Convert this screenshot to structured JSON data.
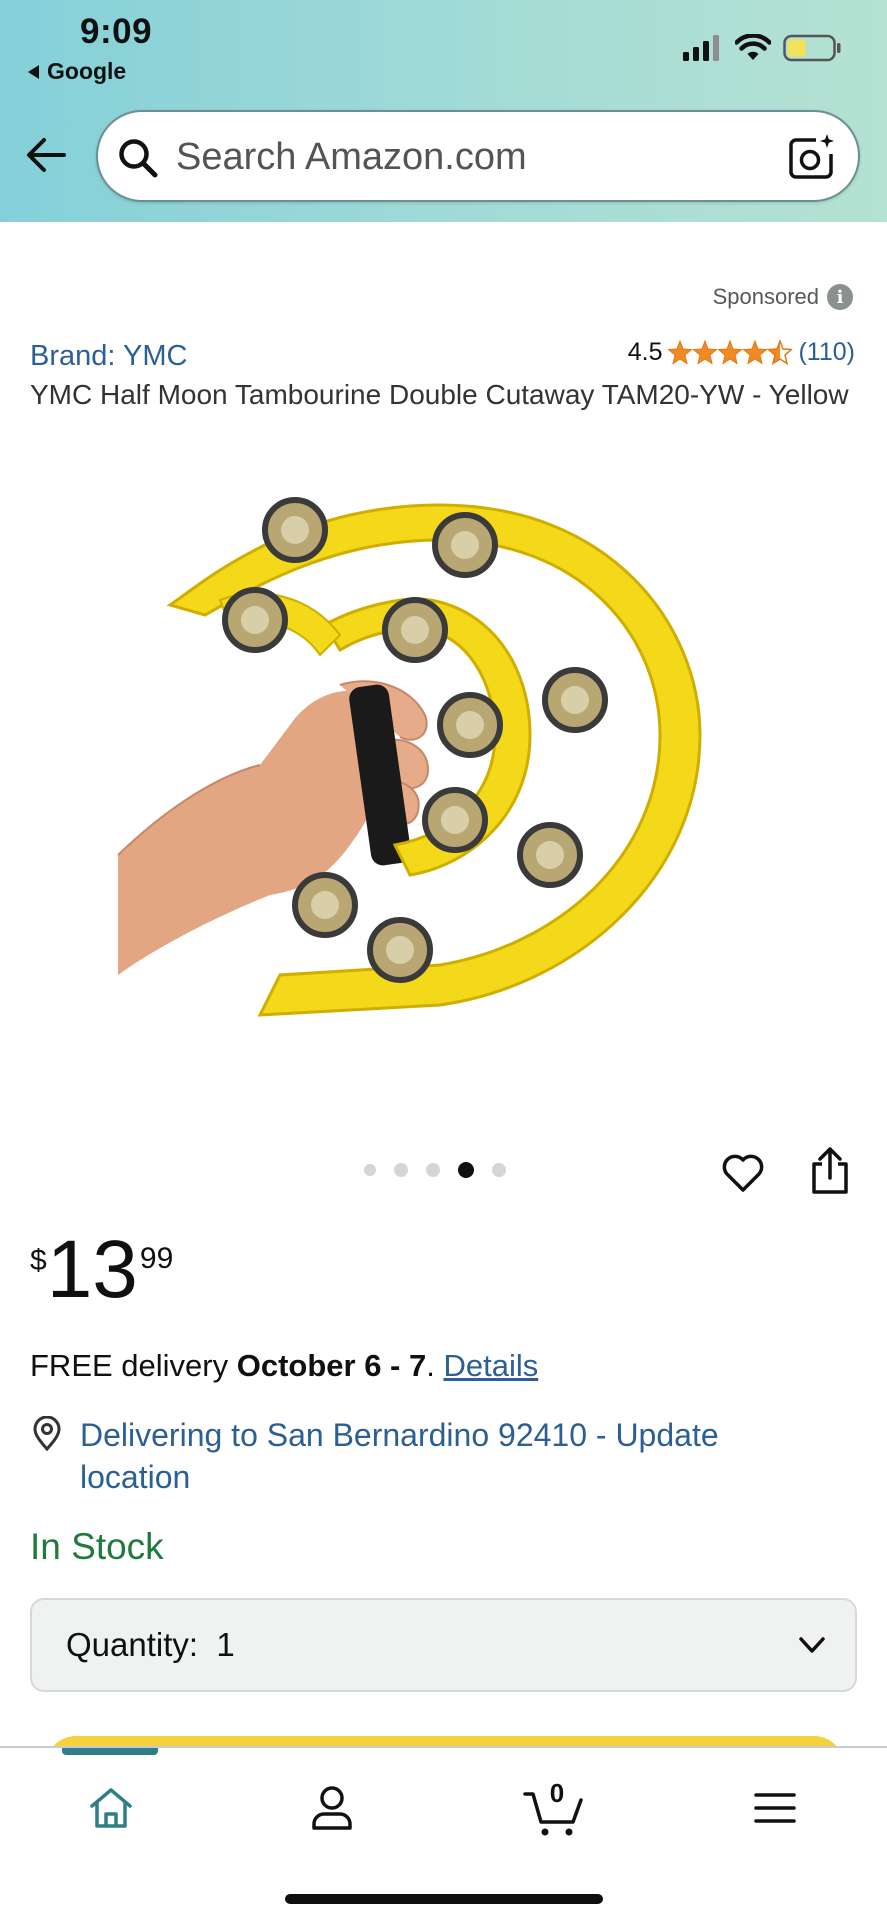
{
  "status_bar": {
    "time": "9:09",
    "back_app": "Google"
  },
  "search": {
    "placeholder": "Search Amazon.com"
  },
  "sponsored_label": "Sponsored",
  "product": {
    "brand": "Brand: YMC",
    "rating": "4.5",
    "rating_stars": 4.5,
    "review_count": "(110)",
    "title": "YMC Half Moon Tambourine Double Cutaway TAM20-YW - Yellow",
    "image_count": 5,
    "active_image_index": 4,
    "price": {
      "currency": "$",
      "whole": "13",
      "fraction": "99"
    },
    "delivery": {
      "prefix": "FREE delivery ",
      "dates": "October 6 - 7",
      "separator": ". ",
      "link": "Details"
    },
    "location": "Delivering to San Bernardino 92410 - Update location",
    "stock": "In Stock",
    "quantity_label": "Quantity:",
    "quantity_value": "1"
  },
  "tabbar": {
    "cart_count": "0",
    "active_tab": "home"
  },
  "colors": {
    "link": "#2c5f93",
    "in_stock": "#1f7a3c",
    "star": "#f08a24",
    "header_gradient_start": "#84d0d9",
    "active_tab": "#2f7f89",
    "add_to_cart": "#f4d23e"
  }
}
